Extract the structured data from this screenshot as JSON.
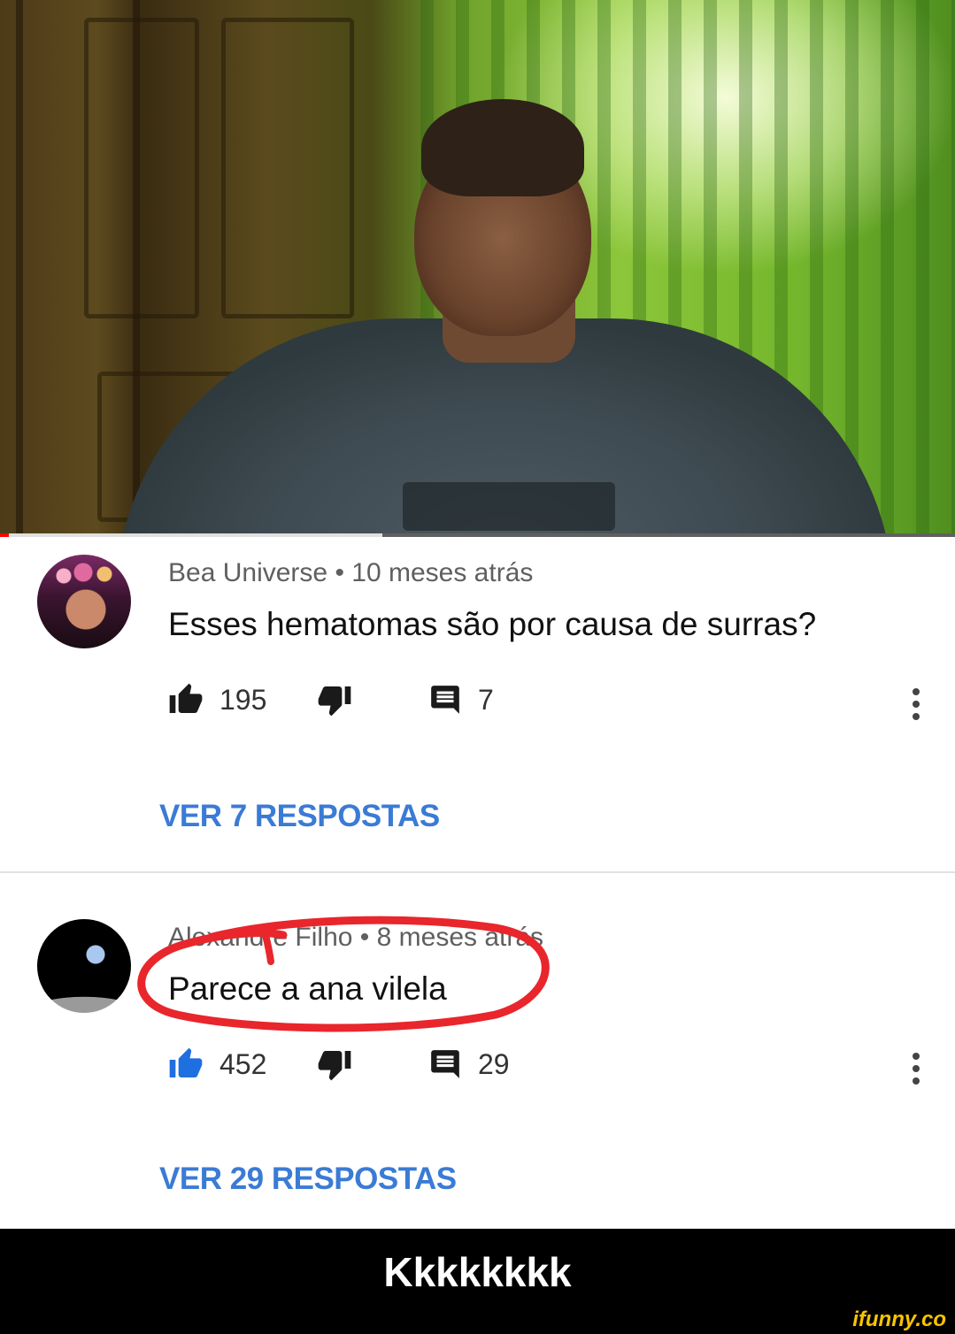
{
  "video": {
    "progress_percent": 40
  },
  "comments": [
    {
      "author": "Bea Universe",
      "time": "10 meses atrás",
      "text": "Esses hematomas  são  por causa de surras?",
      "likes": "195",
      "replies_count": "7",
      "replies_label": "VER 7 RESPOSTAS"
    },
    {
      "meta_visible": "Alexandre Filho • 8 meses atrás",
      "text": "Parece a ana vilela",
      "likes": "452",
      "replies_count": "29",
      "replies_label": "VER 29 RESPOSTAS",
      "liked": true
    }
  ],
  "caption": "Kkkkkkkk",
  "watermark": "ifunny.co",
  "colors": {
    "link_blue": "#3a7bd5",
    "like_active": "#1e6fe0",
    "circle_red": "#e8262c",
    "progress_red": "#ff0000"
  },
  "icons": [
    "thumbs-up-icon",
    "thumbs-down-icon",
    "reply-icon",
    "more-vert-icon"
  ]
}
